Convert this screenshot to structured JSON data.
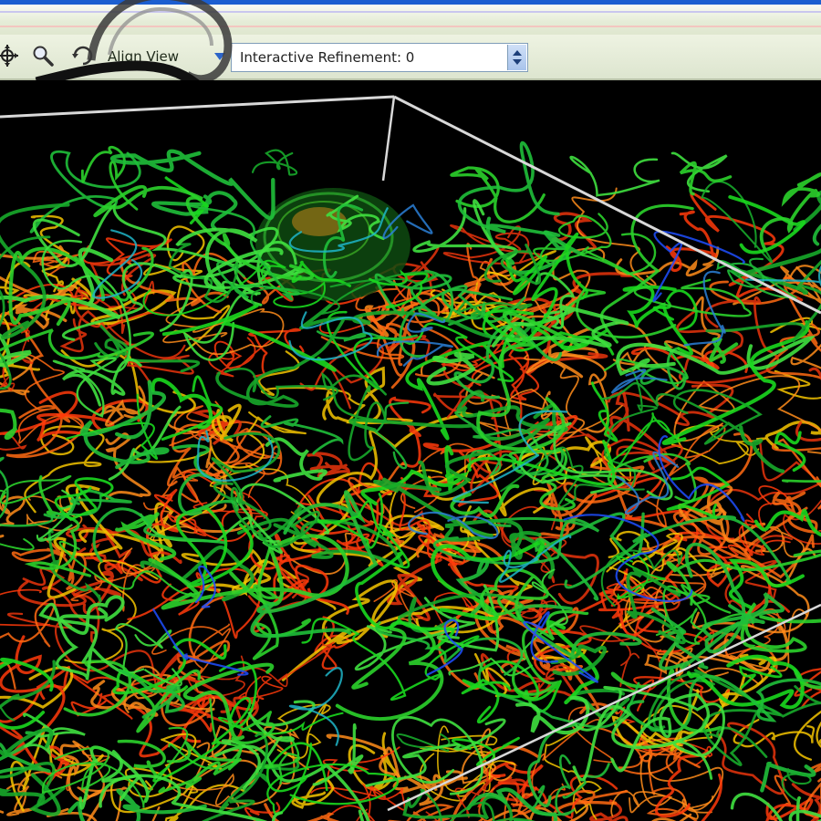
{
  "toolbar": {
    "align_view_label": "Align View",
    "refinement": {
      "value_text": "Interactive Refinement: 0",
      "level": 0
    },
    "icons": [
      "move-icon",
      "zoom-icon",
      "rotate-icon"
    ]
  },
  "viewport": {
    "description_color_map": {
      "low": "#1f4fff",
      "mid_low": "#1fb5c8",
      "mid": "#19d81e",
      "mid_high": "#f5c400",
      "high": "#ff3a0a"
    },
    "bounding_box_color": "#d8d8d8",
    "background": "#000000"
  }
}
